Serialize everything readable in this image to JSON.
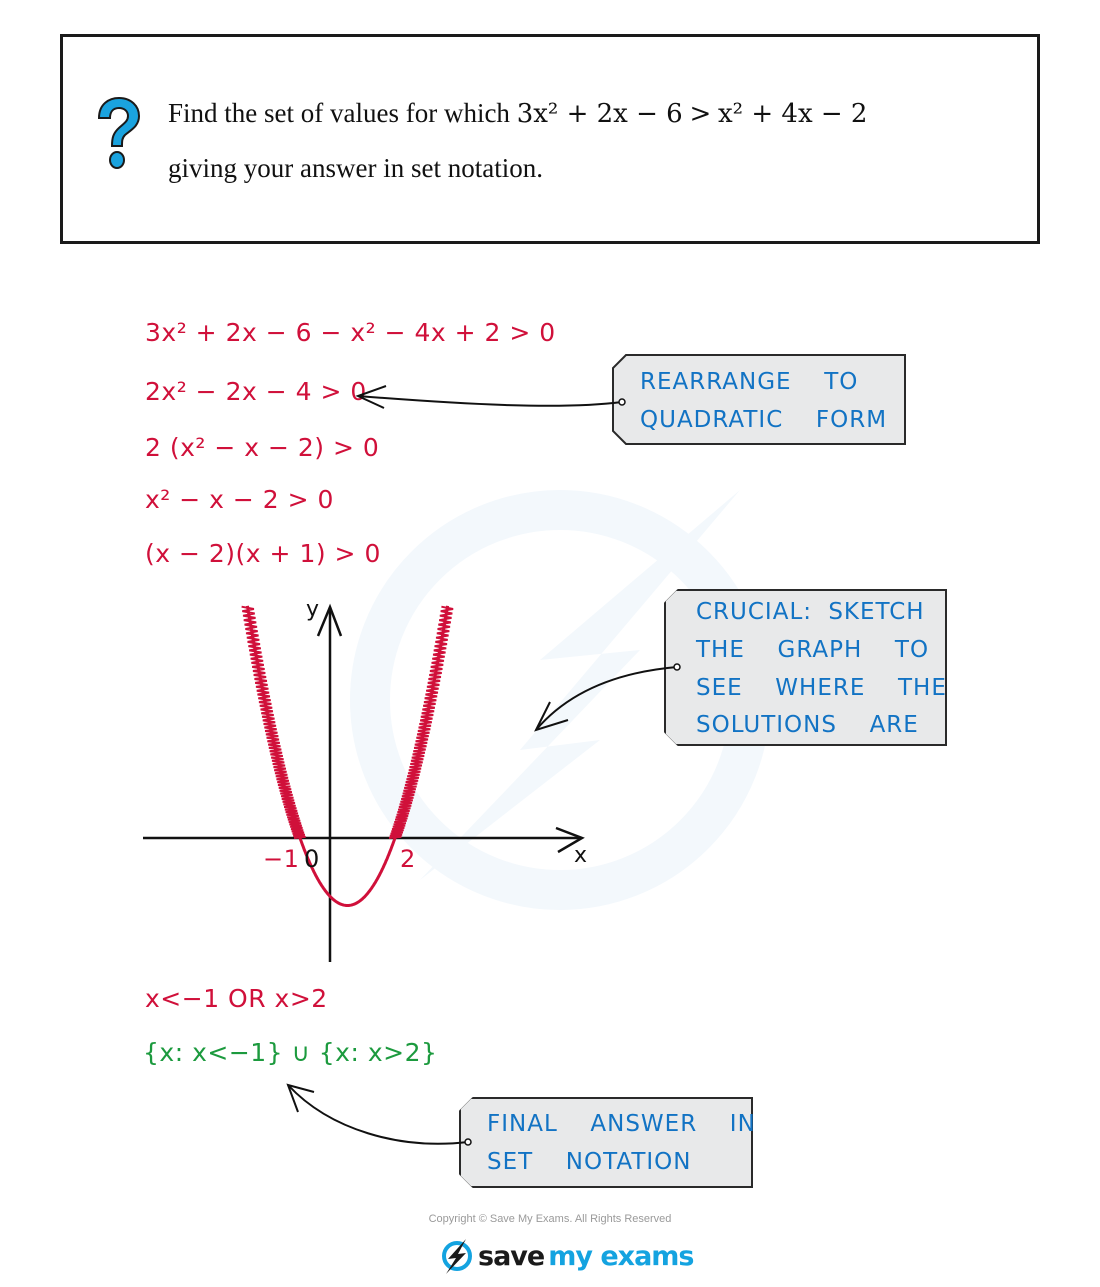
{
  "question": {
    "icon": "question-mark-icon",
    "line1_text": "Find the set of values for which ",
    "inequality_lhs": "3x² + 2x − 6",
    "inequality_op": ">",
    "inequality_rhs": "x² + 4x − 2",
    "line2_text": "giving your answer in set notation."
  },
  "working": {
    "steps": [
      "3x² + 2x − 6 − x² − 4x + 2 > 0",
      "2x² − 2x − 4 > 0",
      "2 (x² − x − 2) > 0",
      "x² − x − 2 > 0",
      "(x − 2)(x + 1) > 0"
    ],
    "solution": "x<−1   OR   x>2",
    "set_answer": "{x: x<−1} ∪ {x: x>2}"
  },
  "graph": {
    "y_axis_label": "y",
    "x_axis_label": "x",
    "origin_label": "0",
    "root_labels": [
      "−1",
      "2"
    ],
    "function": "x² − x − 2",
    "roots": [
      -1,
      2
    ],
    "shaded_regions": [
      "x < -1",
      "x > 2"
    ]
  },
  "annotations": {
    "rearrange": [
      "REARRANGE  TO",
      "QUADRATIC  FORM"
    ],
    "sketch": [
      "CRUCIAL: SKETCH",
      "THE  GRAPH  TO",
      "SEE  WHERE  THE",
      "SOLUTIONS  ARE"
    ],
    "final": [
      "FINAL  ANSWER  IN",
      "SET  NOTATION"
    ]
  },
  "footer": {
    "copyright": "Copyright © Save My Exams. All Rights Reserved",
    "logo_save": "save",
    "logo_rest": "my exams",
    "logo_icon": "lightning-bolt-icon"
  },
  "colors": {
    "working_red": "#d0103a",
    "answer_green": "#1c9a3e",
    "note_blue": "#1273c4",
    "brand_blue": "#14a3e0"
  }
}
